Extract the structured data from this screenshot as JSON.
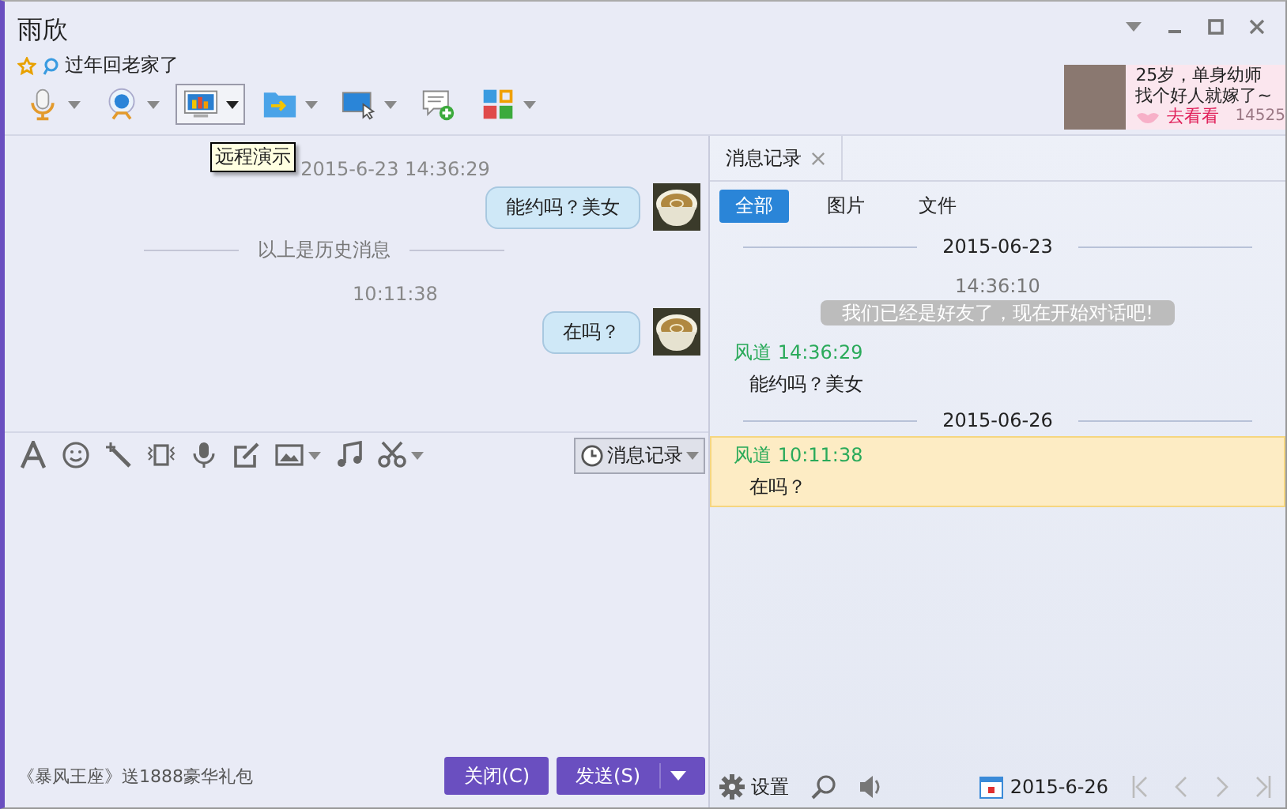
{
  "window": {
    "title": "雨欣",
    "status": "过年回老家了"
  },
  "toolbar": [
    {
      "kind": "microphone",
      "dropdown": true,
      "selected": false
    },
    {
      "kind": "webcam",
      "dropdown": true,
      "selected": false
    },
    {
      "kind": "screen-chart",
      "dropdown": true,
      "selected": true
    },
    {
      "kind": "folder",
      "dropdown": true,
      "selected": false
    },
    {
      "kind": "monitor-cursor",
      "dropdown": true,
      "selected": false
    },
    {
      "kind": "message-add",
      "dropdown": false,
      "selected": false
    },
    {
      "kind": "apps",
      "dropdown": true,
      "selected": false
    }
  ],
  "tooltip": "远程演示",
  "ad": {
    "lines": [
      "25岁，单身幼师",
      "找个好人就嫁了~"
    ],
    "link": "去看看",
    "count": "14525"
  },
  "chat": [
    {
      "kind": "time",
      "text": "2015-6-23 14:36:29"
    },
    {
      "kind": "message",
      "text": "能约吗？美女"
    },
    {
      "kind": "divider",
      "text": "以上是历史消息"
    },
    {
      "kind": "time",
      "text": "10:11:38"
    },
    {
      "kind": "message",
      "text": "在吗？"
    }
  ],
  "input_tools": [
    {
      "kind": "font",
      "dropdown": false
    },
    {
      "kind": "emoji",
      "dropdown": false
    },
    {
      "kind": "wand",
      "dropdown": false
    },
    {
      "kind": "shake",
      "dropdown": false
    },
    {
      "kind": "voice",
      "dropdown": false
    },
    {
      "kind": "edit",
      "dropdown": false
    },
    {
      "kind": "image",
      "dropdown": true
    },
    {
      "kind": "music",
      "dropdown": false
    },
    {
      "kind": "scissors",
      "dropdown": true
    }
  ],
  "history_button": "消息记录",
  "promo": "《暴风王座》送1888豪华礼包",
  "buttons": [
    {
      "label": "关闭(C)",
      "dropdown": false
    },
    {
      "label": "发送(S)",
      "dropdown": true
    }
  ],
  "history": {
    "tab": "消息记录",
    "filters": [
      {
        "label": "全部",
        "selected": true
      },
      {
        "label": "图片",
        "selected": false
      },
      {
        "label": "文件",
        "selected": false
      }
    ],
    "entries": [
      {
        "kind": "date",
        "text": "2015-06-23"
      },
      {
        "kind": "time",
        "text": "14:36:10"
      },
      {
        "kind": "system",
        "text": "我们已经是好友了，现在开始对话吧!"
      },
      {
        "kind": "message",
        "sender": "风道",
        "time": "14:36:29",
        "text": "能约吗？美女",
        "highlighted": false
      },
      {
        "kind": "date",
        "text": "2015-06-26"
      },
      {
        "kind": "message",
        "sender": "风道",
        "time": "10:11:38",
        "text": "在吗？",
        "highlighted": true
      }
    ],
    "settings": "设置",
    "date": "2015-6-26"
  }
}
